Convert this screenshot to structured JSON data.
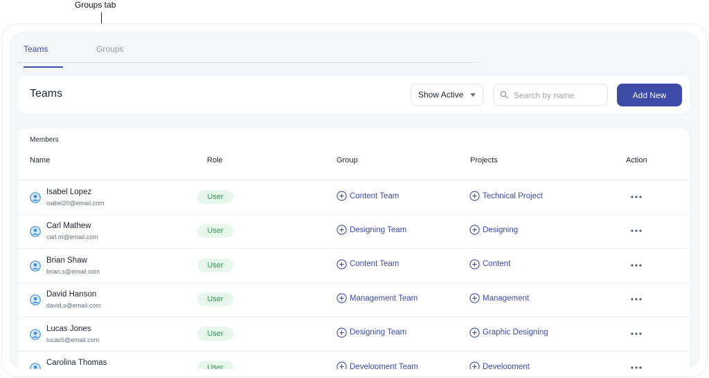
{
  "annotation": {
    "label": "Groups tab"
  },
  "tabs": [
    {
      "label": "Teams",
      "active": true
    },
    {
      "label": "Groups",
      "active": false
    }
  ],
  "toolbar": {
    "title": "Teams",
    "filter_value": "Show Active",
    "search_placeholder": "Search by name",
    "add_label": "Add New"
  },
  "table": {
    "caption": "Members",
    "columns": [
      "Name",
      "Role",
      "Group",
      "Projects",
      "Action"
    ],
    "rows": [
      {
        "name": "Isabel Lopez",
        "email": "isabel20@email.com",
        "role": "User",
        "group": "Content Team",
        "project": "Technical Project"
      },
      {
        "name": "Carl Mathew",
        "email": "carl.m@email.com",
        "role": "User",
        "group": "Designing Team",
        "project": "Designing"
      },
      {
        "name": "Brian Shaw",
        "email": "brian.s@email.com",
        "role": "User",
        "group": "Content Team",
        "project": "Content"
      },
      {
        "name": "David Hanson",
        "email": "david.s@email.com",
        "role": "User",
        "group": "Management Team",
        "project": "Management"
      },
      {
        "name": "Lucas Jones",
        "email": "lucas5@email.com",
        "role": "User",
        "group": "Designing Team",
        "project": "Graphic Designing"
      },
      {
        "name": "Carolina Thomas",
        "email": "",
        "role": "User",
        "group": "Development Team",
        "project": "Development"
      }
    ]
  },
  "colors": {
    "accent": "#3d4ba7",
    "role_badge_bg": "#e8f7ec",
    "role_badge_text": "#2e9a4e",
    "avatar": "#3b8fe0"
  },
  "icons": {
    "avatar": "user-circle-icon",
    "group": "plus-circle-icon",
    "project": "plus-circle-icon",
    "action": "more-horizontal-icon",
    "search": "search-icon",
    "filter": "chevron-down-icon"
  }
}
